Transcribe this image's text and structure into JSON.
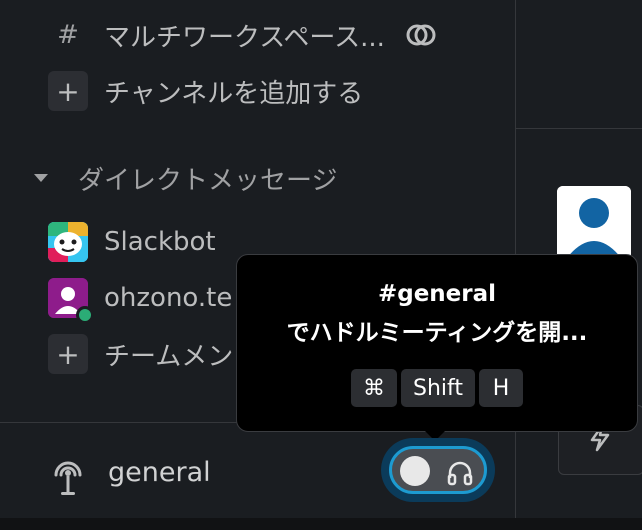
{
  "sidebar": {
    "channels": [
      {
        "label": "マルチワークスペース..."
      },
      {
        "label": "チャンネルを追加する"
      }
    ],
    "dm_section": {
      "label": "ダイレクトメッセージ"
    },
    "dms": [
      {
        "label": "Slackbot"
      },
      {
        "label": "ohzono.te"
      },
      {
        "label": "チームメン"
      }
    ],
    "add_channel_glyph": "+",
    "add_member_glyph": "+"
  },
  "huddle": {
    "channel_name": "general"
  },
  "tooltip": {
    "line1": "#general",
    "line2": "でハドルミーティングを開...",
    "keys": [
      "⌘",
      "Shift",
      "H"
    ]
  },
  "colors": {
    "accent": "#1d9bd1",
    "background": "#1a1d21",
    "online": "#2bac76"
  },
  "icons": [
    "hash-icon",
    "shared-channel-icon",
    "plus-icon",
    "caret-down-icon",
    "slackbot-avatar",
    "user-avatar",
    "huddle-icon",
    "headphones-icon"
  ]
}
